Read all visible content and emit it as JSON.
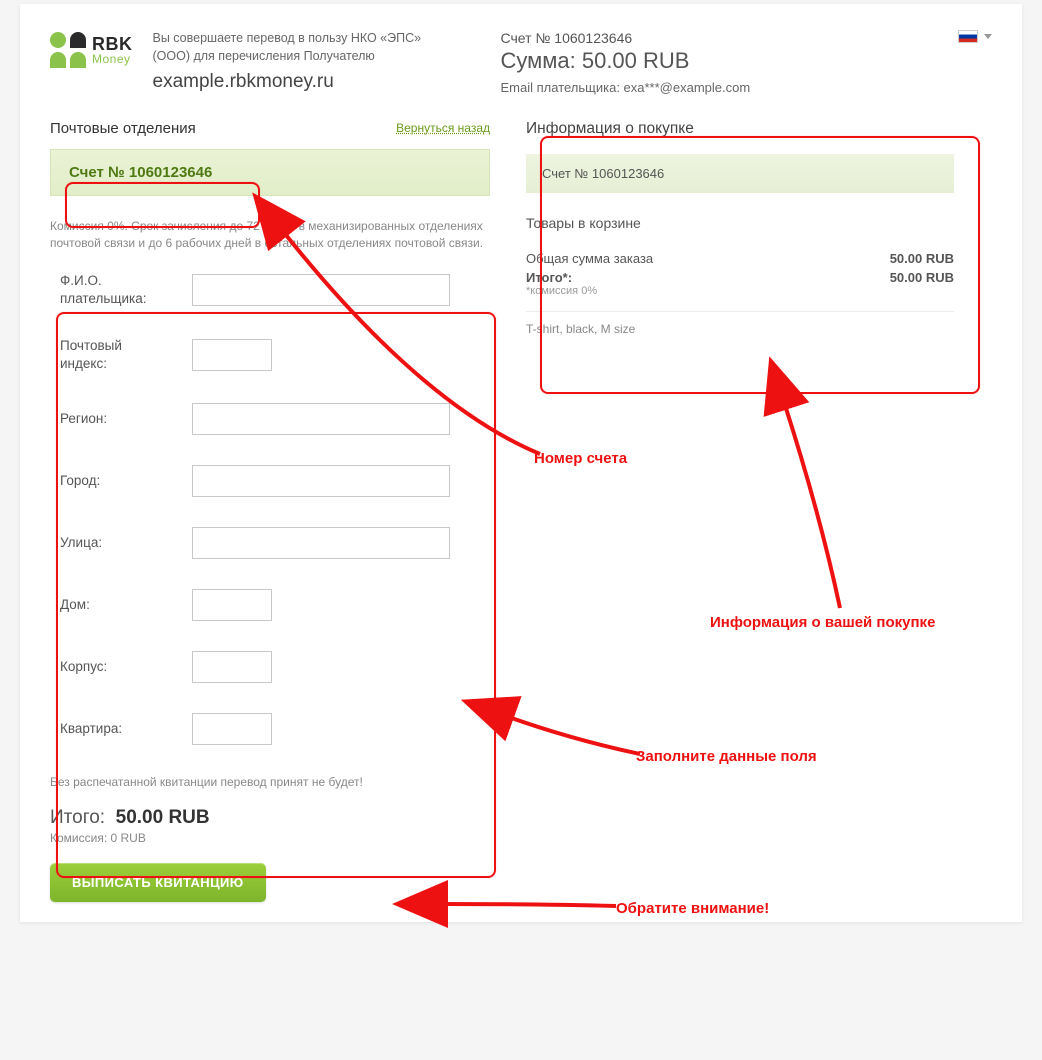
{
  "header": {
    "logo_line1": "RBK",
    "logo_line2": "Money",
    "transfer_note": "Вы совершаете перевод в пользу НКО «ЭПС» (ООО) для перечисления Получателю",
    "merchant": "example.rbkmoney.ru",
    "account_label": "Счет № 1060123646",
    "sum_label": "Сумма: 50.00 RUB",
    "email_label": "Email плательщика: exa***@example.com"
  },
  "left": {
    "title": "Почтовые отделения",
    "back": "Вернуться назад",
    "invoice": "Счет № 1060123646",
    "commission_note": "Комиссия 0%. Срок зачисления до 72 часов в механизированных отделениях почтовой связи и до 6 рабочих дней в остальных отделениях почтовой связи.",
    "fields": {
      "fio": "Ф.И.О. плательщика:",
      "zip": "Почтовый индекс:",
      "region": "Регион:",
      "city": "Город:",
      "street": "Улица:",
      "house": "Дом:",
      "block": "Корпус:",
      "flat": "Квартира:"
    },
    "warning": "Без распечатанной квитанции перевод принят не будет!",
    "total_prefix": "Итого:",
    "total_value": "50.00 RUB",
    "commission_line": "Комиссия: 0 RUB",
    "cta": "ВЫПИСАТЬ КВИТАНЦИЮ"
  },
  "right": {
    "title": "Информация о покупке",
    "banner": "Счет № 1060123646",
    "cart_title": "Товары в корзине",
    "row1_label": "Общая сумма заказа",
    "row1_value": "50.00 RUB",
    "row2_label": "Итого*:",
    "row2_sub": "*комиссия 0%",
    "row2_value": "50.00 RUB",
    "item": "T-shirt, black, M size"
  },
  "callouts": {
    "c1": "Номер счета",
    "c2": "Информация о вашей покупке",
    "c3": "Заполните данные поля",
    "c4": "Обратите внимание!"
  }
}
